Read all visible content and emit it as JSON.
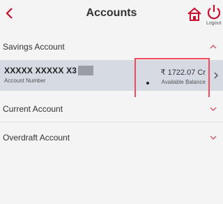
{
  "header": {
    "title": "Accounts",
    "logout_label": "Logout"
  },
  "sections": {
    "savings": {
      "label": "Savings Account",
      "expanded": true
    },
    "current": {
      "label": "Current Account",
      "expanded": false
    },
    "overdraft": {
      "label": "Overdraft Account",
      "expanded": false
    }
  },
  "account": {
    "number": "XXXXX XXXXX X3",
    "number_label": "Account Number",
    "balance": "₹ 1722.07  Cr",
    "balance_label": "Available Balance"
  },
  "colors": {
    "brand": "#c8102e",
    "chevron": "#d85a6a",
    "highlight": "#f24a5c",
    "selected_row": "#d6dae3"
  }
}
